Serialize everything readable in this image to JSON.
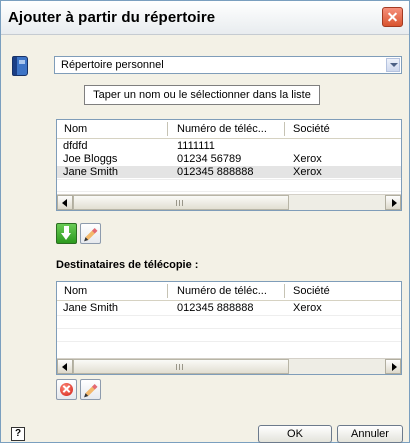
{
  "window": {
    "title": "Ajouter à partir du répertoire"
  },
  "directory": {
    "selected": "Répertoire personnel"
  },
  "search": {
    "placeholder": "Taper un nom ou le sélectionner dans la liste"
  },
  "columns": [
    "Nom",
    "Numéro de téléc...",
    "Société"
  ],
  "contacts": {
    "rows": [
      {
        "name": "dfdfd",
        "number": "1111111",
        "company": ""
      },
      {
        "name": "Joe Bloggs",
        "number": "01234 56789",
        "company": "Xerox"
      },
      {
        "name": "Jane Smith",
        "number": "012345 888888",
        "company": "Xerox",
        "selected": true
      }
    ]
  },
  "recipients": {
    "title": "Destinataires de télécopie :",
    "rows": [
      {
        "name": "Jane Smith",
        "number": "012345 888888",
        "company": "Xerox"
      }
    ]
  },
  "buttons": {
    "help": "?",
    "ok": "OK",
    "cancel": "Annuler"
  },
  "icons": {
    "close": "close-icon",
    "book": "address-book-icon",
    "add": "green-down-arrow-icon",
    "edit": "pencil-icon",
    "delete": "red-x-icon"
  }
}
